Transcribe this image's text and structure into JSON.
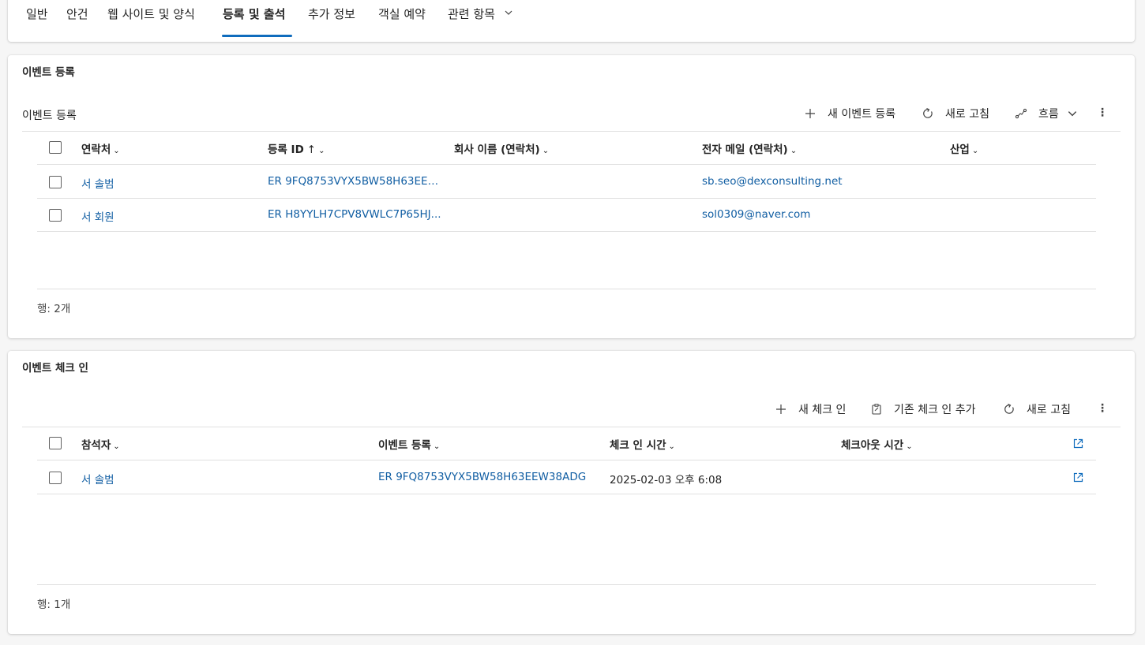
{
  "tabs": [
    {
      "label": "일반"
    },
    {
      "label": "안건"
    },
    {
      "label": "웹 사이트 및 양식"
    },
    {
      "label": "등록 및 출석"
    },
    {
      "label": "추가 정보"
    },
    {
      "label": "객실 예약"
    },
    {
      "label": "관련 항목"
    }
  ],
  "active_tab": "등록 및 출석",
  "registrations": {
    "section_title": "이벤트 등록",
    "grid_title": "이벤트 등록",
    "commands": {
      "new": "새 이벤트 등록",
      "refresh": "새로 고침",
      "flow": "흐름"
    },
    "columns": {
      "contact": "연락처",
      "reg_id": "등록 ID",
      "company": "회사 이름 (연락처)",
      "email": "전자 메일 (연락처)",
      "industry": "산업"
    },
    "rows": [
      {
        "contact": "서 솔범",
        "reg_id": "ER 9FQ8753VYX5BW58H63EEW...",
        "company": "",
        "email": "sb.seo@dexconsulting.net",
        "industry": ""
      },
      {
        "contact": "서 회원",
        "reg_id": "ER H8YYLH7CPV8VWLC7P65HJ...",
        "company": "",
        "email": "sol0309@naver.com",
        "industry": ""
      }
    ],
    "row_count": "행: 2개"
  },
  "checkins": {
    "section_title": "이벤트 체크 인",
    "commands": {
      "new": "새 체크 인",
      "add_existing": "기존 체크 인 추가",
      "refresh": "새로 고침"
    },
    "columns": {
      "attendee": "참석자",
      "event_reg": "이벤트 등록",
      "checkin_time": "체크 인 시간",
      "checkout_time": "체크아웃 시간"
    },
    "rows": [
      {
        "attendee": "서 솔범",
        "event_reg": "ER 9FQ8753VYX5BW58H63EEW38ADG",
        "checkin_time": "2025-02-03 오후 6:08",
        "checkout_time": ""
      }
    ],
    "row_count": "행: 1개"
  },
  "colors": {
    "accent": "#0f6cbd",
    "link": "#115ea3"
  }
}
